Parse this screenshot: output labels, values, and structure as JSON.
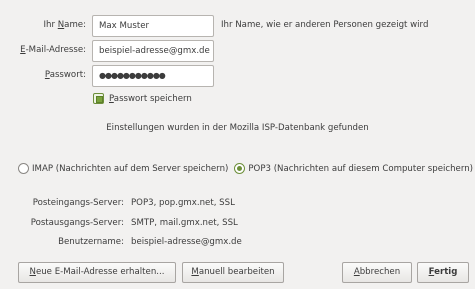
{
  "form": {
    "name_label_pre": "Ihr ",
    "name_label_key": "N",
    "name_label_post": "ame:",
    "name_value": "Max Muster",
    "name_hint": "Ihr Name, wie er anderen Personen gezeigt wird",
    "email_label_key": "E",
    "email_label_post": "-Mail-Adresse:",
    "email_value": "beispiel-adresse@gmx.de",
    "password_label_key": "P",
    "password_label_post": "asswort:",
    "password_value": "●●●●●●●●●●●",
    "remember_key": "P",
    "remember_post": "asswort speichern",
    "remember_checked": true
  },
  "status_message": "Einstellungen wurden in der Mozilla ISP-Datenbank gefunden",
  "protocol": {
    "imap_label": "IMAP (Nachrichten auf dem Server speichern)",
    "pop3_label": "POP3 (Nachrichten auf diesem Computer speichern)",
    "selected": "POP3"
  },
  "server_info": {
    "incoming_label": "Posteingangs-Server:",
    "incoming_value": "POP3, pop.gmx.net, SSL",
    "outgoing_label": "Postausgangs-Server:",
    "outgoing_value": "SMTP, mail.gmx.net, SSL",
    "username_label": "Benutzername:",
    "username_value": "beispiel-adresse@gmx.de"
  },
  "buttons": {
    "new_address_key": "N",
    "new_address_post": "eue E-Mail-Adresse erhalten...",
    "manual_key": "M",
    "manual_post": "anuell bearbeiten",
    "cancel_key": "A",
    "cancel_post": "bbrechen",
    "done_key": "F",
    "done_post": "ertig"
  },
  "colors": {
    "background": "#f2f1f0",
    "accent": "#6d8f3a"
  }
}
